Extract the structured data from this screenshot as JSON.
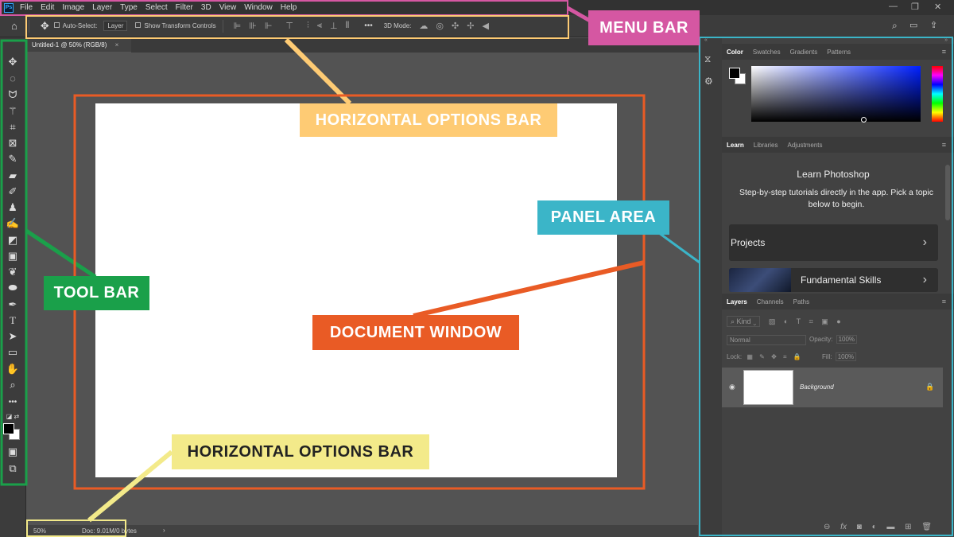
{
  "menubar": {
    "logo": "Ps",
    "items": [
      "File",
      "Edit",
      "Image",
      "Layer",
      "Type",
      "Select",
      "Filter",
      "3D",
      "View",
      "Window",
      "Help"
    ]
  },
  "options_bar": {
    "auto_select_label": "Auto-Select:",
    "auto_select_value": "Layer",
    "show_transform_label": "Show Transform Controls",
    "more": "•••",
    "mode_3d_label": "3D Mode:"
  },
  "document": {
    "tab_title": "Untitled-1 @ 50% (RGB/8)",
    "zoom": "50%",
    "doc_info": "Doc: 9.01M/0 bytes"
  },
  "color_panel": {
    "tabs": [
      "Color",
      "Swatches",
      "Gradients",
      "Patterns"
    ]
  },
  "learn_panel": {
    "tabs": [
      "Learn",
      "Libraries",
      "Adjustments"
    ],
    "title": "Learn Photoshop",
    "description": "Step-by-step tutorials directly in the app. Pick a topic below to begin.",
    "cards": [
      "Projects",
      "Fundamental Skills"
    ]
  },
  "layers_panel": {
    "tabs": [
      "Layers",
      "Channels",
      "Paths"
    ],
    "kind_placeholder": "Kind",
    "blend_mode": "Normal",
    "opacity_label": "Opacity:",
    "opacity_value": "100%",
    "lock_label": "Lock:",
    "fill_label": "Fill:",
    "fill_value": "100%",
    "layer_name": "Background"
  },
  "annotations": {
    "menu_bar": "MENU BAR",
    "options_bar_top": "HORIZONTAL OPTIONS BAR",
    "panel_area": "PANEL AREA",
    "tool_bar": "TOOL BAR",
    "document_window": "DOCUMENT WINDOW",
    "options_bar_bottom": "HORIZONTAL OPTIONS BAR"
  },
  "colors": {
    "menu_bar": "#d557a2",
    "options_bar_top": "#fecb74",
    "panel_area": "#3bb5c8",
    "tool_bar": "#1aa04a",
    "document_window": "#e95b25",
    "options_bar_bottom": "#f3ea8a"
  },
  "icons": {
    "tools": [
      "move-icon",
      "marquee-icon",
      "lasso-icon",
      "magic-wand-icon",
      "crop-icon",
      "frame-icon",
      "eyedropper-icon",
      "healing-brush-icon",
      "brush-icon",
      "clone-stamp-icon",
      "history-brush-icon",
      "eraser-icon",
      "gradient-icon",
      "blur-icon",
      "dodge-icon",
      "pen-icon",
      "type-icon",
      "path-selection-icon",
      "rectangle-icon",
      "hand-icon",
      "zoom-icon",
      "more-tools-icon",
      "default-colors-icon",
      "foreground-background-icon",
      "quick-mask-icon",
      "screen-mode-icon"
    ]
  }
}
